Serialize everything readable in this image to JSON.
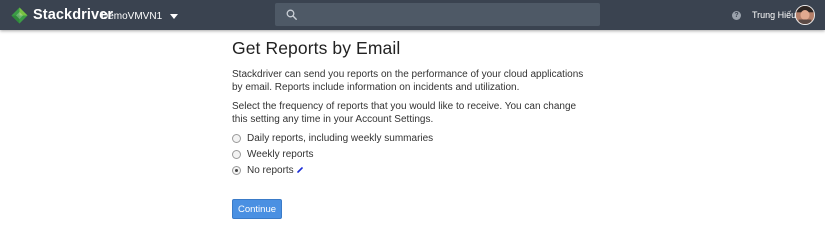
{
  "app": {
    "name": "Stackdriver"
  },
  "header": {
    "project": "DemoVMVN1",
    "search_placeholder": "",
    "user_name": "Trung Hiếu",
    "help_glyph": "?"
  },
  "page": {
    "title": "Get Reports by Email",
    "intro": "Stackdriver can send you reports on the performance of your cloud applications by email. Reports include information on incidents and utilization.",
    "frequency_prompt": "Select the frequency of reports that you would like to receive. You can change this setting any time in your Account Settings.",
    "options": [
      {
        "label": "Daily reports, including weekly summaries",
        "selected": false
      },
      {
        "label": "Weekly reports",
        "selected": false
      },
      {
        "label": "No reports",
        "selected": true
      }
    ],
    "continue_label": "Continue"
  },
  "colors": {
    "topbar": "#3a4350",
    "search_bg": "#4e5966",
    "logo_green": "#4caf50",
    "button": "#4a90e2"
  },
  "icons": [
    "stackdriver-logo-icon",
    "chevron-down-icon",
    "search-icon",
    "help-icon",
    "avatar"
  ]
}
